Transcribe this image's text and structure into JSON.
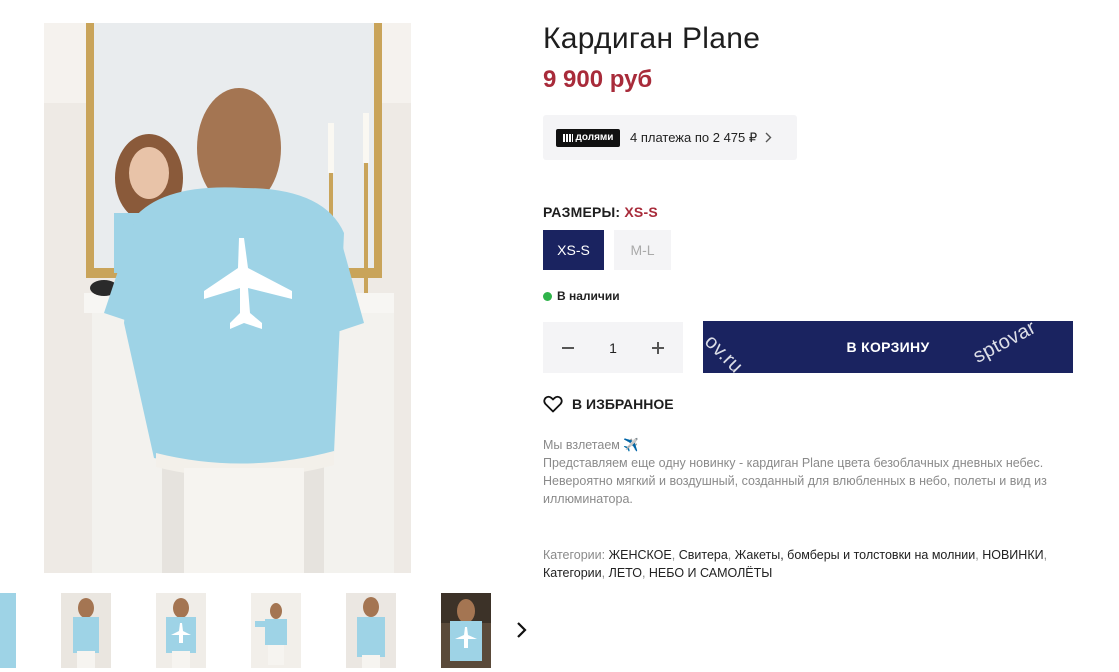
{
  "product": {
    "title": "Кардиган Plane",
    "price": "9 900 руб"
  },
  "dolyami": {
    "logo_label": "долями",
    "text": "4 платежа по 2 475 ₽"
  },
  "sizes": {
    "label": "РАЗМЕРЫ:",
    "selected": "XS-S",
    "options": [
      "XS-S",
      "M-L"
    ]
  },
  "stock": {
    "label": "В наличии",
    "color": "#2fb34a"
  },
  "quantity": {
    "value": "1"
  },
  "cart": {
    "label": "В КОРЗИНУ",
    "watermark_1": "ov.ru",
    "watermark_2": "sptovar"
  },
  "favorite": {
    "label": "В ИЗБРАННОЕ"
  },
  "description": {
    "line1": "Мы взлетаем ✈️",
    "line2": "Представляем еще одну новинку - кардиган Plane цвета безоблачных дневных небес.",
    "line3": "Невероятно мягкий и воздушный, созданный для влюбленных в небо, полеты и вид из иллюминатора."
  },
  "categories": {
    "label": "Категории:",
    "items": [
      "ЖЕНСКОЕ",
      "Свитера",
      "Жакеты, бомберы и толстовки на молнии",
      "НОВИНКИ",
      "Категории",
      "ЛЕТО",
      "НЕБО И САМОЛЁТЫ"
    ]
  },
  "colors": {
    "accent": "#1a2360",
    "price": "#a82b3a",
    "cardigan": "#9ed3e6"
  },
  "icons": {
    "thumb_next": "chevron-right-icon",
    "favorite": "heart-icon"
  }
}
